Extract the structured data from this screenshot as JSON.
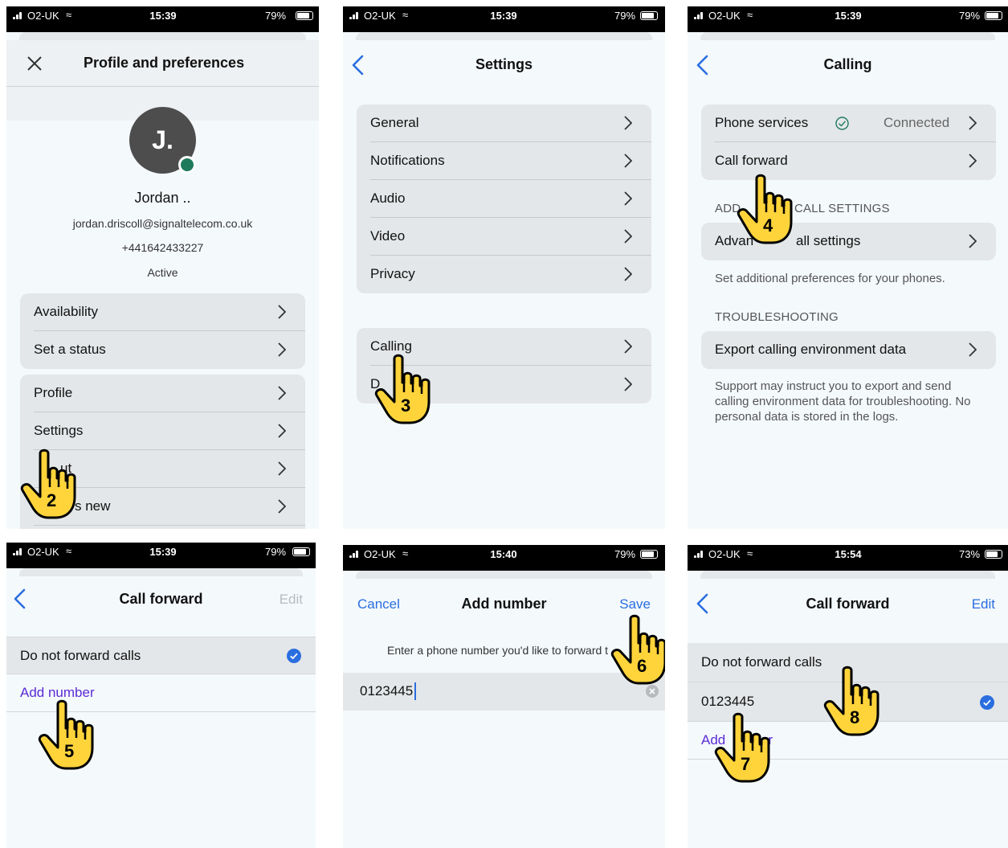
{
  "colors": {
    "accent": "#2a6ee0",
    "link_purple": "#5b2bd6",
    "presence": "#1f7a5c",
    "hand_fill": "#ffd43b"
  },
  "screens": {
    "profile": {
      "status": {
        "carrier": "O2-UK",
        "time": "15:39",
        "battery": "79%"
      },
      "title": "Profile and preferences",
      "avatar_initial": "J.",
      "name": "Jordan ..",
      "email": "jordan.driscoll@signaltelecom.co.uk",
      "phone": "+441642433227",
      "presence_status": "Active",
      "group1": [
        "Availability",
        "Set a status"
      ],
      "group2": [
        "Profile",
        "Settings",
        "ut",
        "s new"
      ],
      "step": "2"
    },
    "settings": {
      "status": {
        "carrier": "O2-UK",
        "time": "15:39",
        "battery": "79%"
      },
      "title": "Settings",
      "group1": [
        "General",
        "Notifications",
        "Audio",
        "Video",
        "Privacy"
      ],
      "group2": [
        "Calling",
        "D"
      ],
      "step": "3"
    },
    "calling": {
      "status": {
        "carrier": "O2-UK",
        "time": "15:39",
        "battery": "79%"
      },
      "title": "Calling",
      "phone_services": "Phone services",
      "connected": "Connected",
      "call_forward": "Call forward",
      "section_additional_left": "ADD",
      "section_additional_right": "CALL SETTINGS",
      "advanced_left": "Advan",
      "advanced_right": "all settings",
      "advanced_note": "Set additional preferences for your phones.",
      "section_troubleshooting": "TROUBLESHOOTING",
      "export": "Export calling environment data",
      "export_note": "Support may instruct you to export and send calling environment data for troubleshooting. No personal data is stored in the logs.",
      "step": "4"
    },
    "call_forward_1": {
      "status": {
        "carrier": "O2-UK",
        "time": "15:39",
        "battery": "79%"
      },
      "title": "Call forward",
      "edit": "Edit",
      "do_not_forward": "Do not forward calls",
      "add_number": "Add number",
      "step": "5"
    },
    "add_number": {
      "status": {
        "carrier": "O2-UK",
        "time": "15:40",
        "battery": "79%"
      },
      "title": "Add number",
      "cancel": "Cancel",
      "save": "Save",
      "prompt": "Enter a phone number you'd like to forward t",
      "input_value": "0123445",
      "step": "6"
    },
    "call_forward_2": {
      "status": {
        "carrier": "O2-UK",
        "time": "15:54",
        "battery": "73%"
      },
      "title": "Call forward",
      "edit": "Edit",
      "do_not_forward": "Do not forward calls",
      "number": "0123445",
      "add_left": "Add",
      "add_right": "er",
      "step_add": "7",
      "step_number": "8"
    }
  }
}
